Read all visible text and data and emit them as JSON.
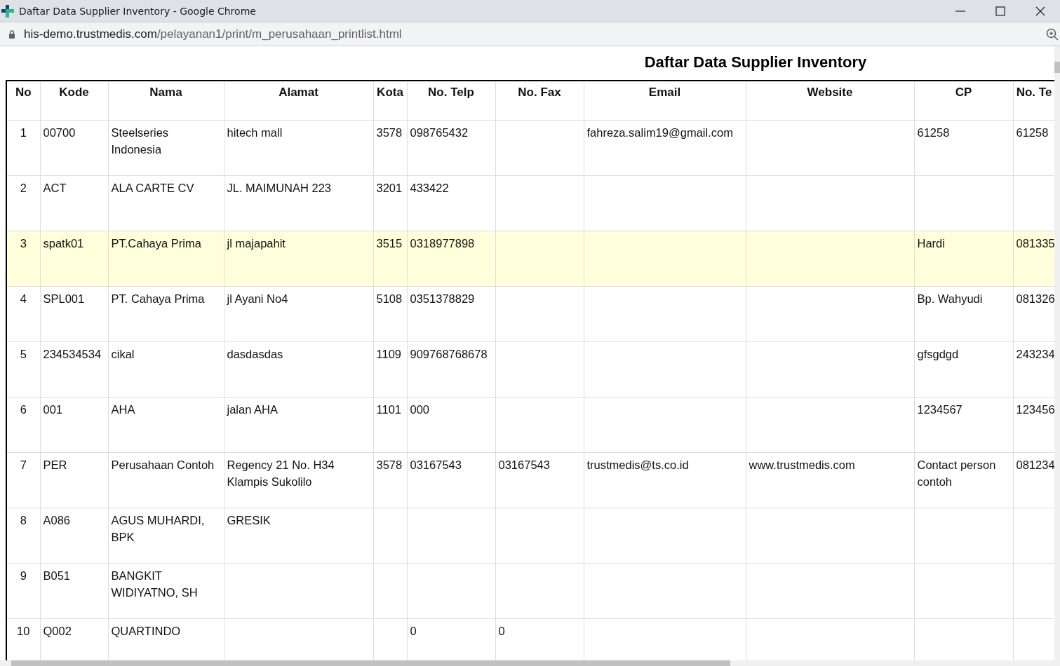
{
  "window": {
    "title": "Daftar Data Supplier Inventory - Google Chrome"
  },
  "address_bar": {
    "url_host": "his-demo.trustmedis.com",
    "url_path": "/pelayanan1/print/m_perusahaan_printlist.html"
  },
  "page": {
    "heading": "Daftar Data Supplier Inventory"
  },
  "table": {
    "columns": [
      "No",
      "Kode",
      "Nama",
      "Alamat",
      "Kota",
      "No. Telp",
      "No. Fax",
      "Email",
      "Website",
      "CP",
      "No. Te"
    ],
    "rows": [
      {
        "highlighted": false,
        "cells": [
          "1",
          "00700",
          "Steelseries Indonesia",
          "hitech mall",
          "3578",
          "098765432",
          "",
          "fahreza.salim19@gmail.com",
          "",
          "61258",
          "61258"
        ]
      },
      {
        "highlighted": false,
        "cells": [
          "2",
          "ACT",
          "ALA CARTE CV",
          "JL. MAIMUNAH 223",
          "3201",
          "433422",
          "",
          "",
          "",
          "",
          ""
        ]
      },
      {
        "highlighted": true,
        "cells": [
          "3",
          "spatk01",
          "PT.Cahaya Prima",
          "jl majapahit",
          "3515",
          "0318977898",
          "",
          "",
          "",
          "Hardi",
          "081335"
        ]
      },
      {
        "highlighted": false,
        "cells": [
          "4",
          "SPL001",
          "PT. Cahaya Prima",
          "jl Ayani No4",
          "5108",
          "0351378829",
          "",
          "",
          "",
          "Bp. Wahyudi",
          "081326"
        ]
      },
      {
        "highlighted": false,
        "cells": [
          "5",
          "234534534",
          "cikal",
          "dasdasdas",
          "1109",
          "909768768678",
          "",
          "",
          "",
          "gfsgdgd",
          "243234"
        ]
      },
      {
        "highlighted": false,
        "cells": [
          "6",
          "001",
          "AHA",
          "jalan AHA",
          "1101",
          "000",
          "",
          "",
          "",
          "1234567",
          "123456"
        ]
      },
      {
        "highlighted": false,
        "cells": [
          "7",
          "PER",
          "Perusahaan Contoh",
          "Regency 21 No. H34 Klampis Sukolilo",
          "3578",
          "03167543",
          "03167543",
          "trustmedis@ts.co.id",
          "www.trustmedis.com",
          "Contact person contoh",
          "081234"
        ]
      },
      {
        "highlighted": false,
        "cells": [
          "8",
          "A086",
          "AGUS MUHARDI, BPK",
          "GRESIK",
          "",
          "",
          "",
          "",
          "",
          "",
          ""
        ]
      },
      {
        "highlighted": false,
        "cells": [
          "9",
          "B051",
          "BANGKIT WIDIYATNO, SH",
          "",
          "",
          "",
          "",
          "",
          "",
          "",
          ""
        ]
      },
      {
        "highlighted": false,
        "cells": [
          "10",
          "Q002",
          "QUARTINDO",
          "",
          "",
          "0",
          "0",
          "",
          "",
          "",
          ""
        ]
      }
    ]
  }
}
